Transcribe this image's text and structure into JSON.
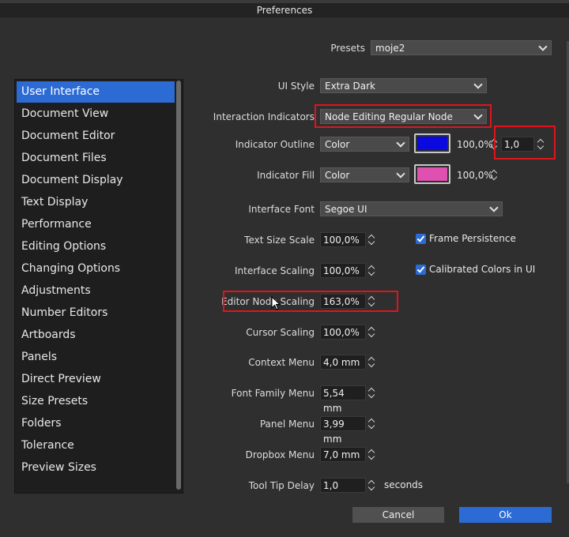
{
  "window": {
    "title": "Preferences"
  },
  "presets": {
    "label": "Presets",
    "value": "moje2"
  },
  "sidebar": {
    "items": [
      {
        "label": "User Interface",
        "selected": true
      },
      {
        "label": "Document View"
      },
      {
        "label": "Document Editor"
      },
      {
        "label": "Document Files"
      },
      {
        "label": "Document Display"
      },
      {
        "label": "Text Display"
      },
      {
        "label": "Performance"
      },
      {
        "label": "Editing Options"
      },
      {
        "label": "Changing Options"
      },
      {
        "label": "Adjustments"
      },
      {
        "label": "Number Editors"
      },
      {
        "label": "Artboards"
      },
      {
        "label": "Panels"
      },
      {
        "label": "Direct Preview"
      },
      {
        "label": "Size Presets"
      },
      {
        "label": "Folders"
      },
      {
        "label": "Tolerance"
      },
      {
        "label": "Preview Sizes"
      }
    ]
  },
  "settings": {
    "ui_style": {
      "label": "UI Style",
      "value": "Extra Dark"
    },
    "interaction_indicators": {
      "label": "Interaction Indicators",
      "value": "Node Editing Regular Node"
    },
    "indicator_outline": {
      "label": "Indicator Outline",
      "mode": "Color",
      "color": "#0a0ae0",
      "opacity": "100,0%",
      "width": "1,0"
    },
    "indicator_fill": {
      "label": "Indicator Fill",
      "mode": "Color",
      "color": "#e050b0",
      "opacity": "100,0%"
    },
    "interface_font": {
      "label": "Interface Font",
      "value": "Segoe UI"
    },
    "text_size_scale": {
      "label": "Text Size Scale",
      "value": "100,0%"
    },
    "interface_scaling": {
      "label": "Interface Scaling",
      "value": "100,0%"
    },
    "editor_node_scaling": {
      "label": "Editor Node Scaling",
      "value": "163,0%"
    },
    "cursor_scaling": {
      "label": "Cursor Scaling",
      "value": "100,0%"
    },
    "context_menu": {
      "label": "Context Menu",
      "value": "4,0 mm"
    },
    "font_family_menu": {
      "label": "Font Family Menu",
      "value": "5,54 mm"
    },
    "panel_menu": {
      "label": "Panel Menu",
      "value": "3,99 mm"
    },
    "dropbox_menu": {
      "label": "Dropbox Menu",
      "value": "7,0 mm"
    },
    "tool_tip_delay": {
      "label": "Tool Tip Delay",
      "value": "1,0",
      "unit": "seconds"
    },
    "frame_persistence": {
      "label": "Frame Persistence",
      "checked": true
    },
    "calibrated_colors": {
      "label": "Calibrated Colors in UI",
      "checked": true
    }
  },
  "buttons": {
    "cancel": "Cancel",
    "ok": "Ok"
  },
  "colors": {
    "accent": "#2c6bd4",
    "highlight_box": "#e0141e"
  }
}
